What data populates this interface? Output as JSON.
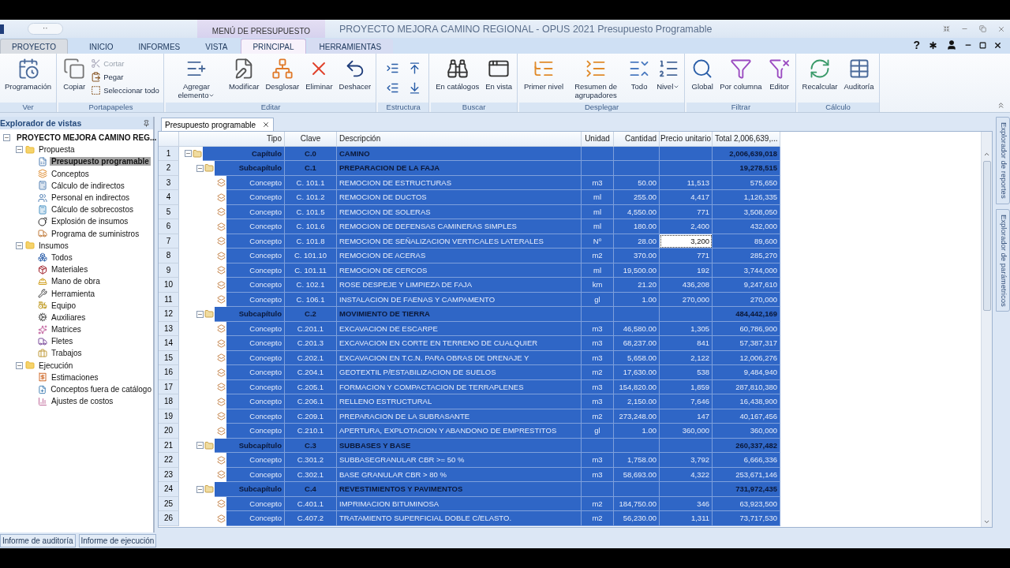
{
  "window": {
    "title": "PROYECTO MEJORA CAMINO REGIONAL - OPUS 2021 Presupuesto Programable",
    "quick_access": "··",
    "context_header": "MENÚ DE PRESUPUESTO"
  },
  "tabs": [
    {
      "label": "PROYECTO",
      "kind": "file",
      "selected": false
    },
    {
      "label": "INICIO",
      "kind": "standard",
      "selected": false
    },
    {
      "label": "INFORMES",
      "kind": "standard",
      "selected": false
    },
    {
      "label": "VISTA",
      "kind": "standard",
      "selected": false
    },
    {
      "label": "PRINCIPAL",
      "kind": "context",
      "selected": true
    },
    {
      "label": "HERRAMIENTAS",
      "kind": "context",
      "selected": false
    }
  ],
  "help": "?",
  "ribbon": [
    {
      "label": "Ver",
      "buttons": [
        {
          "label": "Programación",
          "kind": "large"
        }
      ]
    },
    {
      "label": "Portapapeles",
      "buttons": [
        {
          "label": "Copiar",
          "kind": "large"
        },
        {
          "label": "Cortar",
          "kind": "small",
          "disabled": true
        },
        {
          "label": "Pegar",
          "kind": "small",
          "disabled": false
        },
        {
          "label": "Seleccionar todo",
          "kind": "small",
          "disabled": false
        }
      ]
    },
    {
      "label": "Editar",
      "buttons": [
        {
          "label": "Agregar elemento",
          "kind": "large",
          "dropdown": true
        },
        {
          "label": "Modificar",
          "kind": "large"
        },
        {
          "label": "Desglosar",
          "kind": "large"
        },
        {
          "label": "Eliminar",
          "kind": "large"
        },
        {
          "label": "Deshacer",
          "kind": "large"
        }
      ]
    },
    {
      "label": "Estructura",
      "buttons": [
        {
          "kind": "icon",
          "disabled": false
        },
        {
          "kind": "icon",
          "disabled": false
        },
        {
          "kind": "icon",
          "disabled": false
        },
        {
          "kind": "icon",
          "disabled": false
        }
      ]
    },
    {
      "label": "Buscar",
      "buttons": [
        {
          "label": "En catálogos",
          "kind": "large"
        },
        {
          "label": "En vista",
          "kind": "large"
        }
      ]
    },
    {
      "label": "Desplegar",
      "buttons": [
        {
          "label": "Primer nivel",
          "kind": "large"
        },
        {
          "label": "Resumen de agrupadores",
          "kind": "large"
        },
        {
          "label": "Todo",
          "kind": "large"
        },
        {
          "label": "Nivel",
          "kind": "large",
          "dropdown": true
        }
      ]
    },
    {
      "label": "Filtrar",
      "buttons": [
        {
          "label": "Global",
          "kind": "large"
        },
        {
          "label": "Por columna",
          "kind": "large"
        },
        {
          "label": "Editor",
          "kind": "large"
        }
      ]
    },
    {
      "label": "Cálculo",
      "buttons": [
        {
          "label": "Recalcular",
          "kind": "large"
        },
        {
          "label": "Auditoría",
          "kind": "large"
        }
      ]
    }
  ],
  "explorer": {
    "title": "Explorador de vistas",
    "tree": [
      {
        "label": "PROYECTO MEJORA CAMINO REG...",
        "expanded": true,
        "selected": false,
        "children": [
          {
            "label": "Propuesta",
            "expanded": true,
            "selected": false,
            "children": [
              {
                "label": "Presupuesto programable",
                "selected": true
              },
              {
                "label": "Conceptos",
                "selected": false
              },
              {
                "label": "Cálculo de indirectos",
                "selected": false
              },
              {
                "label": "Personal en indirectos",
                "selected": false
              },
              {
                "label": "Cálculo de sobrecostos",
                "selected": false
              },
              {
                "label": "Explosión de insumos",
                "selected": false
              },
              {
                "label": "Programa de suministros",
                "selected": false
              }
            ]
          },
          {
            "label": "Insumos",
            "expanded": true,
            "selected": false,
            "children": [
              {
                "label": "Todos",
                "selected": false
              },
              {
                "label": "Materiales",
                "selected": false
              },
              {
                "label": "Mano de obra",
                "selected": false
              },
              {
                "label": "Herramienta",
                "selected": false
              },
              {
                "label": "Equipo",
                "selected": false
              },
              {
                "label": "Auxiliares",
                "selected": false
              },
              {
                "label": "Matrices",
                "selected": false
              },
              {
                "label": "Fletes",
                "selected": false
              },
              {
                "label": "Trabajos",
                "selected": false
              }
            ]
          },
          {
            "label": "Ejecución",
            "expanded": true,
            "selected": false,
            "children": [
              {
                "label": "Estimaciones",
                "selected": false
              },
              {
                "label": "Conceptos fuera de catálogo",
                "selected": false
              },
              {
                "label": "Ajustes de costos",
                "selected": false
              }
            ]
          }
        ]
      }
    ]
  },
  "document_tab": {
    "label": "Presupuesto programable"
  },
  "table": {
    "columns": [
      "Tipo",
      "Clave",
      "Descripción",
      "Unidad",
      "Cantidad",
      "Precio unitario",
      "Total 2,006,639,..."
    ],
    "rows": [
      {
        "n": "1",
        "tipo": "Capítulo",
        "clave": "C.0",
        "descripcion": "CAMINO",
        "total": "2,006,639,018",
        "expanded": true,
        "selected": true,
        "focused": false,
        "children": [
          {
            "n": "2",
            "tipo": "Subcapítulo",
            "clave": "C.1",
            "descripcion": "PREPARACION DE LA FAJA",
            "total": "19,278,515",
            "expanded": true,
            "selected": true,
            "focused": false,
            "children": [
              {
                "n": "3",
                "tipo": "Concepto",
                "clave": "C. 101.1",
                "descripcion": "REMOCION DE ESTRUCTURAS",
                "unidad": "m3",
                "cantidad": "50.00",
                "precio": "11,513",
                "total": "575,650",
                "selected": true,
                "focused": false
              },
              {
                "n": "4",
                "tipo": "Concepto",
                "clave": "C. 101.2",
                "descripcion": "REMOCION DE DUCTOS",
                "unidad": "ml",
                "cantidad": "255.00",
                "precio": "4,417",
                "total": "1,126,335",
                "selected": true,
                "focused": false
              },
              {
                "n": "5",
                "tipo": "Concepto",
                "clave": "C. 101.5",
                "descripcion": "REMOCION DE SOLERAS",
                "unidad": "ml",
                "cantidad": "4,550.00",
                "precio": "771",
                "total": "3,508,050",
                "selected": true,
                "focused": false
              },
              {
                "n": "6",
                "tipo": "Concepto",
                "clave": "C. 101.6",
                "descripcion": "REMOCION DE DEFENSAS CAMINERAS SIMPLES",
                "unidad": "ml",
                "cantidad": "180.00",
                "precio": "2,400",
                "total": "432,000",
                "selected": true,
                "focused": false
              },
              {
                "n": "7",
                "tipo": "Concepto",
                "clave": "C. 101.8",
                "descripcion": "REMOCION DE SEÑALIZACION VERTICALES LATERALES",
                "unidad": "Nº",
                "cantidad": "28.00",
                "precio": "3,200",
                "total": "89,600",
                "selected": true,
                "focused": true
              },
              {
                "n": "8",
                "tipo": "Concepto",
                "clave": "C. 101.10",
                "descripcion": "REMOCION DE ACERAS",
                "unidad": "m2",
                "cantidad": "370.00",
                "precio": "771",
                "total": "285,270",
                "selected": true,
                "focused": false
              },
              {
                "n": "9",
                "tipo": "Concepto",
                "clave": "C. 101.11",
                "descripcion": "REMOCION DE CERCOS",
                "unidad": "ml",
                "cantidad": "19,500.00",
                "precio": "192",
                "total": "3,744,000",
                "selected": true,
                "focused": false
              },
              {
                "n": "10",
                "tipo": "Concepto",
                "clave": "C. 102.1",
                "descripcion": "ROSE DESPEJE Y LIMPIEZA DE FAJA",
                "unidad": "km",
                "cantidad": "21.20",
                "precio": "436,208",
                "total": "9,247,610",
                "selected": true,
                "focused": false
              },
              {
                "n": "11",
                "tipo": "Concepto",
                "clave": "C. 106.1",
                "descripcion": "INSTALACION DE FAENAS Y CAMPAMENTO",
                "unidad": "gl",
                "cantidad": "1.00",
                "precio": "270,000",
                "total": "270,000",
                "selected": true,
                "focused": false
              }
            ]
          },
          {
            "n": "12",
            "tipo": "Subcapítulo",
            "clave": "C.2",
            "descripcion": "MOVIMIENTO DE TIERRA",
            "total": "484,442,169",
            "expanded": true,
            "selected": true,
            "focused": false,
            "children": [
              {
                "n": "13",
                "tipo": "Concepto",
                "clave": "C.201.1",
                "descripcion": "EXCAVACION DE ESCARPE",
                "unidad": "m3",
                "cantidad": "46,580.00",
                "precio": "1,305",
                "total": "60,786,900",
                "selected": true,
                "focused": false
              },
              {
                "n": "14",
                "tipo": "Concepto",
                "clave": "C.201.3",
                "descripcion": "EXCAVACION EN CORTE EN TERRENO DE CUALQUIER",
                "unidad": "m3",
                "cantidad": "68,237.00",
                "precio": "841",
                "total": "57,387,317",
                "selected": true,
                "focused": false
              },
              {
                "n": "15",
                "tipo": "Concepto",
                "clave": "C.202.1",
                "descripcion": "EXCAVACION EN T.C.N. PARA OBRAS DE DRENAJE Y",
                "unidad": "m3",
                "cantidad": "5,658.00",
                "precio": "2,122",
                "total": "12,006,276",
                "selected": true,
                "focused": false
              },
              {
                "n": "16",
                "tipo": "Concepto",
                "clave": "C.204.1",
                "descripcion": "GEOTEXTIL P/ESTABILIZACION DE SUELOS",
                "unidad": "m2",
                "cantidad": "17,630.00",
                "precio": "538",
                "total": "9,484,940",
                "selected": true,
                "focused": false
              },
              {
                "n": "17",
                "tipo": "Concepto",
                "clave": "C.205.1",
                "descripcion": "FORMACION Y COMPACTACION DE TERRAPLENES",
                "unidad": "m3",
                "cantidad": "154,820.00",
                "precio": "1,859",
                "total": "287,810,380",
                "selected": true,
                "focused": false
              },
              {
                "n": "18",
                "tipo": "Concepto",
                "clave": "C.206.1",
                "descripcion": "RELLENO ESTRUCTURAL",
                "unidad": "m3",
                "cantidad": "2,150.00",
                "precio": "7,646",
                "total": "16,438,900",
                "selected": true,
                "focused": false
              },
              {
                "n": "19",
                "tipo": "Concepto",
                "clave": "C.209.1",
                "descripcion": "PREPARACION DE LA SUBRASANTE",
                "unidad": "m2",
                "cantidad": "273,248.00",
                "precio": "147",
                "total": "40,167,456",
                "selected": true,
                "focused": false
              },
              {
                "n": "20",
                "tipo": "Concepto",
                "clave": "C.210.1",
                "descripcion": "APERTURA, EXPLOTACION Y ABANDONO DE EMPRESTITOS",
                "unidad": "gl",
                "cantidad": "1.00",
                "precio": "360,000",
                "total": "360,000",
                "selected": true,
                "focused": false
              }
            ]
          },
          {
            "n": "21",
            "tipo": "Subcapítulo",
            "clave": "C.3",
            "descripcion": "SUBBASES Y BASE",
            "total": "260,337,482",
            "expanded": true,
            "selected": true,
            "focused": false,
            "children": [
              {
                "n": "22",
                "tipo": "Concepto",
                "clave": "C.301.2",
                "descripcion": "SUBBASEGRANULAR CBR >= 50 %",
                "unidad": "m3",
                "cantidad": "1,758.00",
                "precio": "3,792",
                "total": "6,666,336",
                "selected": true,
                "focused": false
              },
              {
                "n": "23",
                "tipo": "Concepto",
                "clave": "C.302.1",
                "descripcion": "BASE GRANULAR CBR > 80 %",
                "unidad": "m3",
                "cantidad": "58,693.00",
                "precio": "4,322",
                "total": "253,671,146",
                "selected": true,
                "focused": false
              }
            ]
          },
          {
            "n": "24",
            "tipo": "Subcapítulo",
            "clave": "C.4",
            "descripcion": "REVESTIMIENTOS Y PAVIMENTOS",
            "total": "731,972,435",
            "expanded": true,
            "selected": true,
            "focused": false,
            "children": [
              {
                "n": "25",
                "tipo": "Concepto",
                "clave": "C.401.1",
                "descripcion": "IMPRIMACION BITUMINOSA",
                "unidad": "m2",
                "cantidad": "184,750.00",
                "precio": "346",
                "total": "63,923,500",
                "selected": true,
                "focused": false
              },
              {
                "n": "26",
                "tipo": "Concepto",
                "clave": "C.407.2",
                "descripcion": "TRATAMIENTO SUPERFICIAL DOBLE C/ELASTO.",
                "unidad": "m2",
                "cantidad": "56,230.00",
                "precio": "1,311",
                "total": "73,717,530",
                "selected": true,
                "focused": false
              }
            ]
          }
        ]
      }
    ]
  },
  "side_tabs": [
    "Explorador de reportes",
    "Explorador de parámetricos"
  ],
  "bottom_tabs": [
    "Informe de auditoría",
    "Informe de ejecución"
  ]
}
